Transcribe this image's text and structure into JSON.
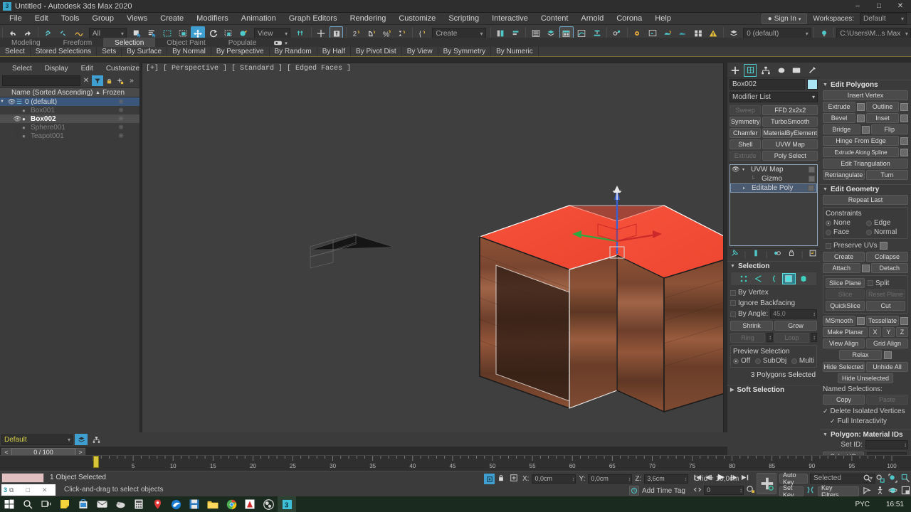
{
  "window": {
    "title": "Untitled - Autodesk 3ds Max 2020",
    "app_icon": "3ds-max-icon",
    "minimize": "–",
    "maximize": "□",
    "close": "✕"
  },
  "menubar": {
    "items": [
      "File",
      "Edit",
      "Tools",
      "Group",
      "Views",
      "Create",
      "Modifiers",
      "Animation",
      "Graph Editors",
      "Rendering",
      "Customize",
      "Scripting",
      "Interactive",
      "Content",
      "Arnold",
      "Corona",
      "Help"
    ]
  },
  "account": {
    "sign_in": "Sign In",
    "workspaces_label": "Workspaces:",
    "workspace_value": "Default"
  },
  "main_toolbar": {
    "select_filter": "All",
    "reference_coord": "View",
    "selection_set": "Create Selection Se",
    "layer": "0 (default)",
    "project_path": "C:\\Users\\M...s Max 2020"
  },
  "ribbon": {
    "tabs": [
      "Modeling",
      "Freeform",
      "Selection",
      "Object Paint",
      "Populate"
    ],
    "active_tab": "Selection",
    "buttons": [
      "Select",
      "Stored Selections",
      "Sets",
      "By Surface",
      "By Normal",
      "By Perspective",
      "By Random",
      "By Half",
      "By Pivot Dist",
      "By View",
      "By Symmetry",
      "By Numeric"
    ]
  },
  "explorer": {
    "menu": [
      "Select",
      "Display",
      "Edit",
      "Customize"
    ],
    "search_value": "",
    "col_name": "Name (Sorted Ascending)",
    "col_frozen": "Frozen",
    "rows": [
      {
        "label": "0 (default)",
        "depth": 0,
        "state": "layer",
        "hidden": false
      },
      {
        "label": "Box001",
        "depth": 1,
        "state": "normal",
        "hidden": true
      },
      {
        "label": "Box002",
        "depth": 1,
        "state": "selected",
        "hidden": false
      },
      {
        "label": "Sphere001",
        "depth": 1,
        "state": "normal",
        "hidden": true
      },
      {
        "label": "Teapot001",
        "depth": 1,
        "state": "normal",
        "hidden": true
      }
    ]
  },
  "viewport": {
    "label": "[+] [ Perspective ] [ Standard ] [ Edged Faces ]",
    "selection_color": "#ff4433",
    "gizmo_axis_z": "#3a5fd0"
  },
  "command_panel": {
    "tabs": [
      "create-tab",
      "modify-tab",
      "hierarchy-tab",
      "motion-tab",
      "display-tab",
      "utilities-tab"
    ],
    "active_tab": "modify-tab",
    "object_name": "Box002",
    "object_color": "#a9e4f5",
    "modifier_list": "Modifier List",
    "modifier_buttons": [
      {
        "label": "Sweep",
        "disabled": true
      },
      {
        "label": "FFD 2x2x2",
        "disabled": false
      },
      {
        "label": "Symmetry",
        "disabled": false
      },
      {
        "label": "TurboSmooth",
        "disabled": false
      },
      {
        "label": "Chamfer",
        "disabled": false
      },
      {
        "label": "MaterialByElement",
        "disabled": false
      },
      {
        "label": "Shell",
        "disabled": false
      },
      {
        "label": "UVW Map",
        "disabled": false
      },
      {
        "label": "Extrude",
        "disabled": true
      },
      {
        "label": "Poly Select",
        "disabled": false
      }
    ],
    "stack": [
      {
        "label": "UVW Map",
        "indent": 0,
        "selected": false,
        "eye": true,
        "arrow": "▾"
      },
      {
        "label": "Gizmo",
        "indent": 1,
        "selected": false,
        "eye": false,
        "arrow": ""
      },
      {
        "label": "Editable Poly",
        "indent": 0,
        "selected": true,
        "eye": false,
        "arrow": "▸"
      }
    ],
    "selection": {
      "title": "Selection",
      "sub_object_icons": [
        "vertex-icon",
        "edge-icon",
        "border-icon",
        "polygon-icon",
        "element-icon"
      ],
      "active_sub_object": "polygon-icon",
      "by_vertex": "By Vertex",
      "ignore_backfacing": "Ignore Backfacing",
      "by_angle": "By Angle:",
      "by_angle_value": "45,0",
      "shrink": "Shrink",
      "grow": "Grow",
      "ring": "Ring",
      "loop": "Loop",
      "preview_title": "Preview Selection",
      "preview_options": [
        "Off",
        "SubObj",
        "Multi"
      ],
      "preview_selected": "Off",
      "status": "3 Polygons Selected"
    },
    "soft_selection": {
      "title": "Soft Selection"
    },
    "edit_polygons": {
      "title": "Edit Polygons",
      "insert_vertex": "Insert Vertex",
      "rows": [
        {
          "left": "Extrude",
          "left_box": true,
          "right": "Outline",
          "right_box": true
        },
        {
          "left": "Bevel",
          "left_box": true,
          "right": "Inset",
          "right_box": true
        },
        {
          "left": "Bridge",
          "left_box": true,
          "right": "Flip",
          "right_box": false
        }
      ],
      "hinge_from_edge": "Hinge From Edge",
      "extrude_along_spline": "Extrude Along Spline",
      "edit_triangulation": "Edit Triangulation",
      "retriangulate": "Retriangulate",
      "turn": "Turn"
    },
    "edit_geometry": {
      "title": "Edit Geometry",
      "repeat_last": "Repeat Last",
      "constraints_label": "Constraints",
      "constraints": [
        "None",
        "Edge",
        "Face",
        "Normal"
      ],
      "constraint_selected": "None",
      "preserve_uvs": "Preserve UVs",
      "create": "Create",
      "collapse": "Collapse",
      "attach": "Attach",
      "detach": "Detach",
      "slice_plane": "Slice Plane",
      "split": "Split",
      "slice": "Slice",
      "reset_plane": "Reset Plane",
      "quickslice": "QuickSlice",
      "cut": "Cut",
      "msmooth": "MSmooth",
      "tessellate": "Tessellate",
      "make_planar": "Make Planar",
      "axis_x": "X",
      "axis_y": "Y",
      "axis_z": "Z",
      "view_align": "View Align",
      "grid_align": "Grid Align",
      "relax": "Relax",
      "hide_selected": "Hide Selected",
      "unhide_all": "Unhide All",
      "hide_unselected": "Hide Unselected",
      "named_selections": "Named Selections:",
      "copy": "Copy",
      "paste": "Paste",
      "delete_isolated": "Delete Isolated Vertices",
      "full_interactivity": "Full Interactivity"
    },
    "material_ids": {
      "title": "Polygon: Material IDs",
      "set_id_label": "Set ID:",
      "set_id_value": "",
      "select_id": "Select ID",
      "select_id_value": ""
    }
  },
  "track": {
    "layer_name": "Default",
    "time_value": "0 / 100",
    "prev": "<",
    "next": ">",
    "ruler_ticks": [
      0,
      5,
      10,
      15,
      20,
      25,
      30,
      35,
      40,
      45,
      50,
      55,
      60,
      65,
      70,
      75,
      80,
      85,
      90,
      95,
      100
    ]
  },
  "statusbar": {
    "object_selected": "1 Object Selected",
    "prompt": "Click-and-drag to select objects",
    "x_label": "X:",
    "x_value": "0,0cm",
    "y_label": "Y:",
    "y_value": "0,0cm",
    "z_label": "Z:",
    "z_value": "3,6cm",
    "grid": "Grid = 10,0cm",
    "add_time_tag": "Add Time Tag",
    "auto_key": "Auto Key",
    "set_key": "Set Key",
    "key_mode": "Selected",
    "key_filters": "Key Filters...",
    "frame_value": "0"
  },
  "taskbar": {
    "items": [
      "start-icon",
      "search-icon",
      "task-view-icon",
      "sticky-notes-icon",
      "store-icon",
      "mail-icon",
      "weather-icon",
      "calculator-icon",
      "maps-icon",
      "edge-icon",
      "save-icon",
      "explorer-icon",
      "chrome-icon",
      "acrobat-icon",
      "obs-icon",
      "3dsmax-icon"
    ],
    "active": "3dsmax-icon",
    "lang": "PYC",
    "time": "16:51"
  }
}
